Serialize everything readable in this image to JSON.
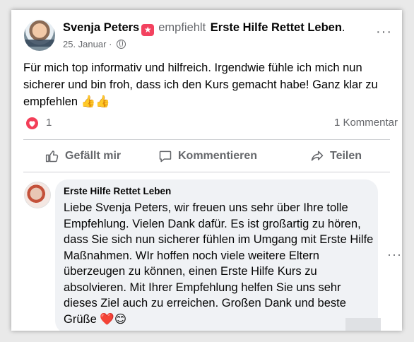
{
  "post": {
    "author": "Svenja Peters",
    "recommend_word": "empfiehlt",
    "page_name": "Erste Hilfe Rettet Leben",
    "page_name_suffix": ".",
    "date": "25. Januar",
    "date_separator": "·",
    "text": "Für mich top informativ und hilfreich. Irgendwie fühle ich mich nun sicherer und bin froh, dass ich den Kurs gemacht habe! Ganz klar zu empfehlen 👍👍",
    "more_icon": "···"
  },
  "stats": {
    "reaction_icon": "heart-reaction-icon",
    "reaction_count": "1",
    "comment_count": "1 Kommentar"
  },
  "actions": {
    "like_label": "Gefällt mir",
    "comment_label": "Kommentieren",
    "share_label": "Teilen"
  },
  "comment": {
    "author": "Erste Hilfe Rettet Leben",
    "text": "Liebe Svenja Peters, wir freuen uns sehr über Ihre tolle Empfehlung. Vielen Dank dafür. Es ist großartig zu hören, dass Sie sich nun sicherer fühlen im Umgang mit Erste Hilfe Maßnahmen. WIr hoffen noch viele weitere Eltern überzeugen zu können, einen Erste Hilfe Kurs zu absolvieren. Mit Ihrer Empfehlung helfen Sie uns sehr dieses Ziel auch zu erreichen. Großen Dank und beste Grüße ❤️😊",
    "more_icon": "···"
  },
  "colors": {
    "reaction": "#f33e58",
    "recommend_badge": "#f3425f",
    "secondary_text": "#65676b",
    "bubble": "#f0f2f5"
  }
}
